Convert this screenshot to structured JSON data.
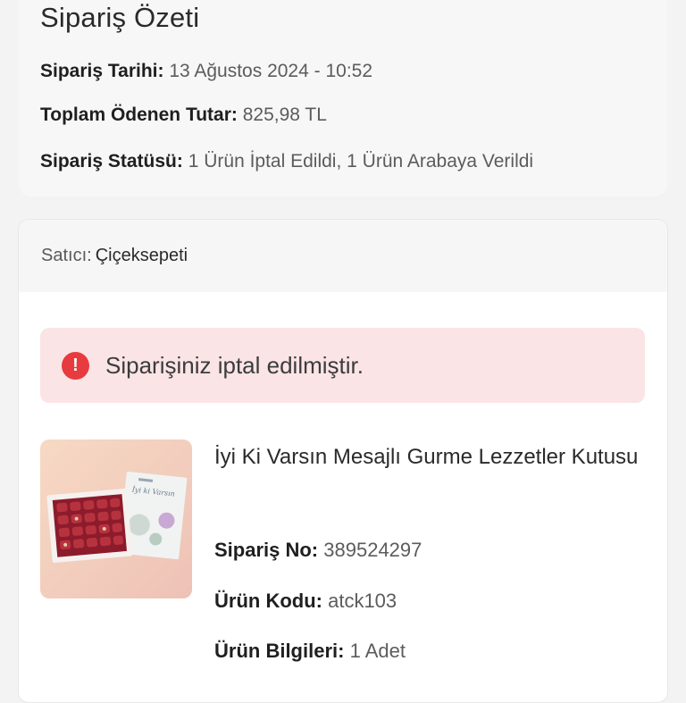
{
  "summary": {
    "title": "Sipariş Özeti",
    "order_date_label": "Sipariş Tarihi:",
    "order_date_value": "13 Ağustos 2024 - 10:52",
    "total_label": "Toplam Ödenen Tutar:",
    "total_value": "825,98 TL",
    "status_label": "Sipariş Statüsü:",
    "status_value": "1 Ürün İptal Edildi, 1 Ürün Arabaya Verildi"
  },
  "seller": {
    "label": "Satıcı:",
    "name": "Çiçeksepeti"
  },
  "alert": {
    "icon": "exclamation-circle-icon",
    "text": "Siparişiniz iptal edilmiştir.",
    "color": "#e83b3f",
    "background": "#fbe4e5"
  },
  "product": {
    "name": "İyi Ki Varsın Mesajlı Gurme Lezzetler Kutusu",
    "order_no_label": "Sipariş No:",
    "order_no_value": "389524297",
    "code_label": "Ürün Kodu:",
    "code_value": "atck103",
    "info_label": "Ürün Bilgileri:",
    "info_value": "1 Adet",
    "image_card_text": "İyi ki Varsın"
  }
}
